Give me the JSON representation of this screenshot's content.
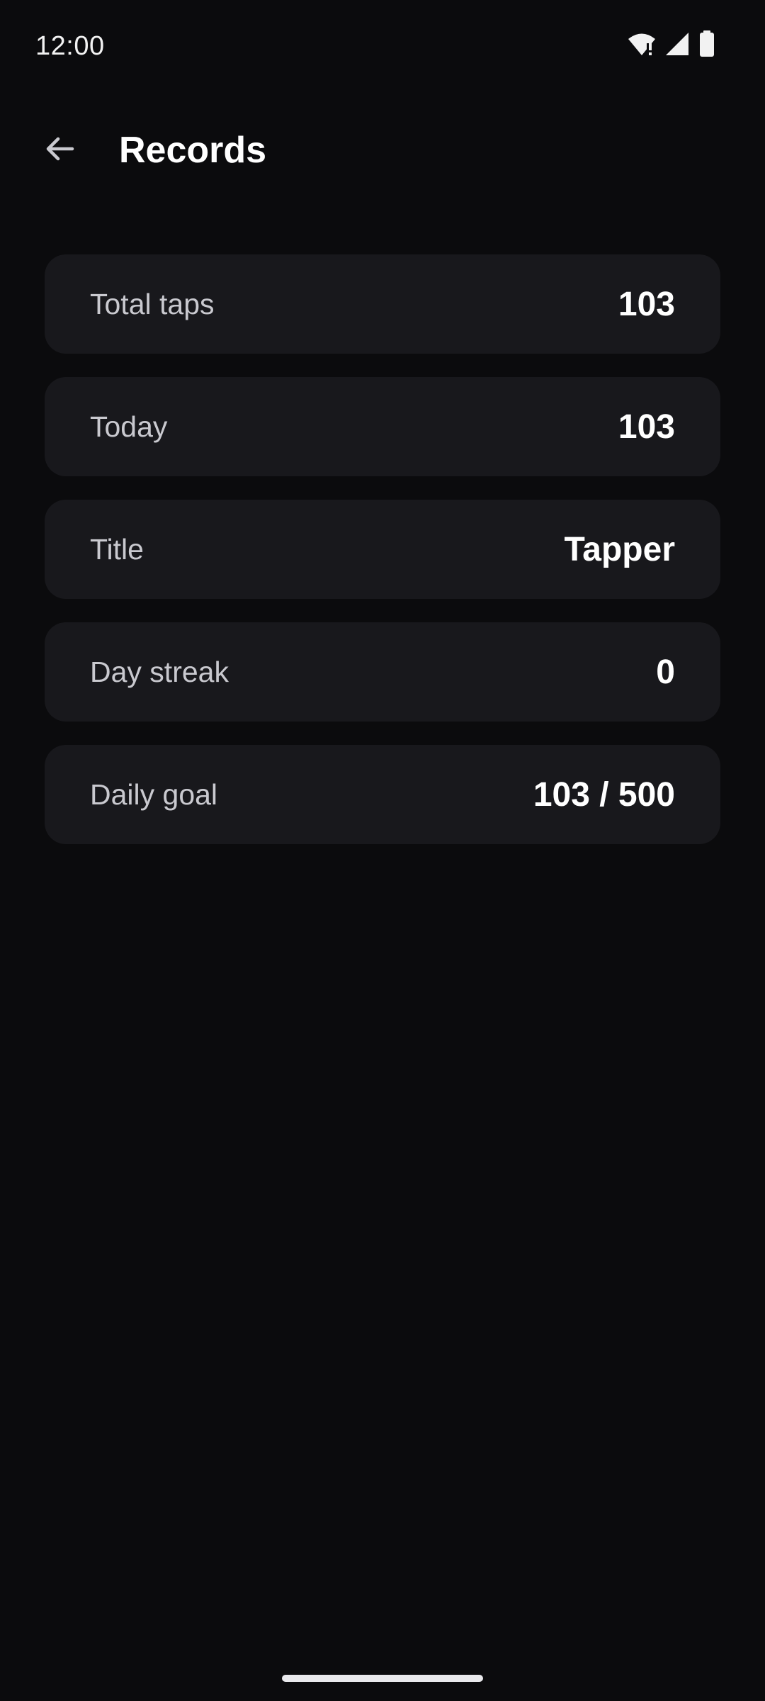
{
  "status_bar": {
    "time": "12:00",
    "icons": [
      "wifi-alert-icon",
      "cellular-signal-icon",
      "battery-icon"
    ]
  },
  "app_bar": {
    "back_icon": "arrow-back-icon",
    "title": "Records"
  },
  "records": [
    {
      "label": "Total taps",
      "value": "103"
    },
    {
      "label": "Today",
      "value": "103"
    },
    {
      "label": "Title",
      "value": "Tapper"
    },
    {
      "label": "Day streak",
      "value": "0"
    },
    {
      "label": "Daily goal",
      "value": "103 / 500"
    }
  ],
  "colors": {
    "background": "#0b0b0d",
    "card": "#18181c",
    "label": "#c9c9cf",
    "value": "#ffffff"
  }
}
